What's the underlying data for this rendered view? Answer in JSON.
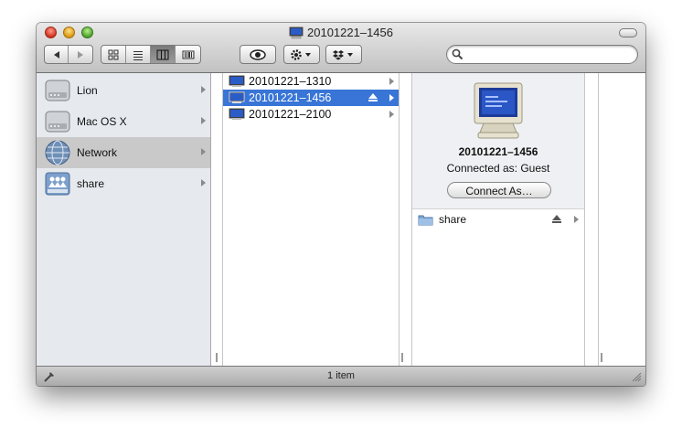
{
  "window": {
    "title": "20101221–1456"
  },
  "toolbar": {
    "back_label": "◀",
    "forward_label": "▶",
    "views": [
      "icon-view",
      "list-view",
      "column-view",
      "coverflow-view"
    ],
    "active_view": "column-view",
    "quicklook": "eye-icon",
    "action": "gear-icon",
    "dropbox": "dropbox-icon",
    "search": {
      "value": "",
      "placeholder": ""
    }
  },
  "sidebar": {
    "items": [
      {
        "label": "Lion",
        "icon": "hard-drive-icon"
      },
      {
        "label": "Mac OS X",
        "icon": "hard-drive-icon"
      },
      {
        "label": "Network",
        "icon": "network-globe-icon",
        "selected": true
      },
      {
        "label": "share",
        "icon": "shared-drive-icon"
      }
    ]
  },
  "column1": {
    "rows": [
      {
        "label": "20101221–1310",
        "icon": "computer-icon"
      },
      {
        "label": "20101221–1456",
        "icon": "computer-icon",
        "selected": true,
        "eject": true
      },
      {
        "label": "20101221–2100",
        "icon": "computer-icon"
      }
    ]
  },
  "preview": {
    "name": "20101221–1456",
    "connected_as": "Connected as: Guest",
    "connect_button": "Connect As…",
    "share_item": {
      "label": "share",
      "icon": "shared-folder-icon"
    }
  },
  "status": {
    "text": "1 item"
  },
  "colors": {
    "selection": "#3875d7",
    "sidebar_bg": "#e6eaef"
  }
}
